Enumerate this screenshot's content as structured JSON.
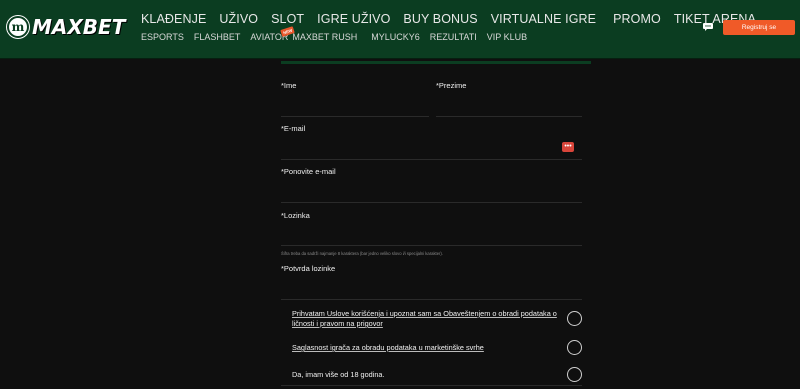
{
  "brand": {
    "logo_letter": "m",
    "name": "MAXBET"
  },
  "nav": {
    "main": [
      "KLAĐENJE",
      "UŽIVO",
      "SLOT",
      "IGRE UŽIVO",
      "BUY BONUS",
      "VIRTUALNE IGRE",
      "PROMO",
      "TIKET ARENA"
    ],
    "sub": [
      "ESPORTS",
      "FLASHBET",
      "AVIATOR",
      "MAXBET RUSH",
      "MYLUCKY6",
      "REZULTATI",
      "VIP KLUB"
    ],
    "new_tag": "NEW"
  },
  "header": {
    "register_label": "Registruj se"
  },
  "form": {
    "first_name_label": "*Ime",
    "last_name_label": "*Prezime",
    "email_label": "*E-mail",
    "email_repeat_label": "*Ponovite e-mail",
    "password_label": "*Lozinka",
    "password_hint": "Šifra treba da sadrži najmanje 8 karaktera (bar jedno veliko slovo i/i specijalni karakter).",
    "password_confirm_label": "*Potvrda lozinke",
    "dots_button": "•••",
    "consents": [
      "Prihvatam Uslove korišćenja i upoznat sam sa Obaveštenjem o obradi podataka o ličnosti i pravom na prigovor",
      "Saglasnost igrača za obradu podataka u marketinške svrhe",
      "Da, imam više od 18 godina."
    ]
  },
  "colors": {
    "header_bg": "#0b3d21",
    "page_bg": "#0f0f0f",
    "accent": "#f05a28",
    "dots_button": "#d9453a"
  }
}
